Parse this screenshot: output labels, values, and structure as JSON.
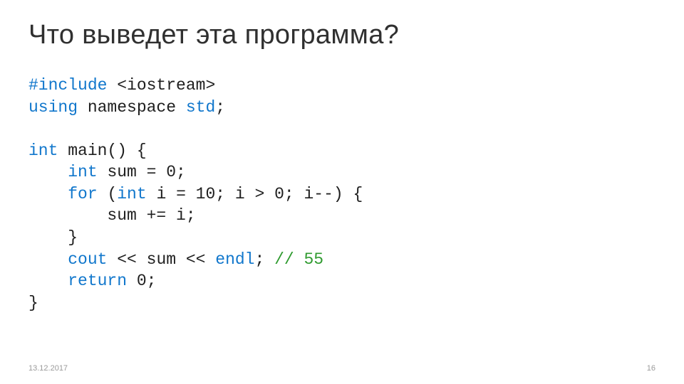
{
  "title": "Что выведет эта программа?",
  "code": {
    "l1_include": "#include",
    "l1_header": " <iostream>",
    "l2_using": "using",
    "l2_namespace": " namespace ",
    "l2_std": "std",
    "l2_tail": ";",
    "l3_int": "int",
    "l3_rest": " main() {",
    "l4_indent": "    ",
    "l4_int": "int",
    "l4_rest": " sum = 0;",
    "l5_indent": "    ",
    "l5_for": "for",
    "l5_paren": " (",
    "l5_int": "int",
    "l5_rest": " i = 10; i > 0; i--) {",
    "l6": "        sum += i;",
    "l7": "    }",
    "l8_indent": "    ",
    "l8_cout": "cout",
    "l8_mid": " << sum << ",
    "l8_endl": "endl",
    "l8_tail": "; ",
    "l8_comment": "// 55",
    "l9_indent": "    ",
    "l9_return": "return",
    "l9_rest": " 0;",
    "l10": "}"
  },
  "footer": {
    "date": "13.12.2017",
    "page": "16"
  }
}
